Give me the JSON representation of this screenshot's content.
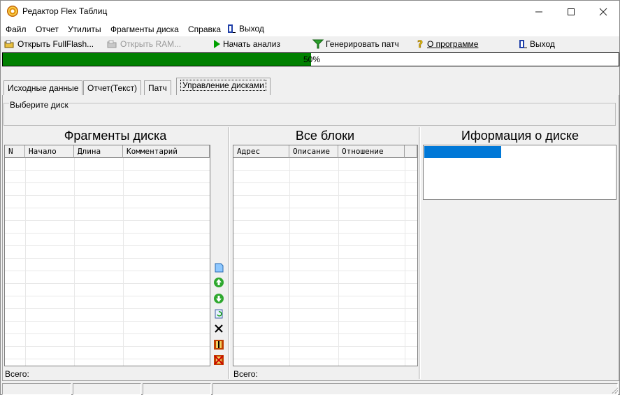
{
  "window": {
    "title": "Редактор Flex Таблиц",
    "controls": {
      "minimize": "—",
      "maximize": "☐",
      "close": "✕"
    }
  },
  "menu": [
    "Файл",
    "Отчет",
    "Утилиты",
    "Фрагменты диска",
    "Справка",
    "Выход"
  ],
  "toolbar": {
    "open_fullflash": "Открыть FullFlash...",
    "open_ram": "Открыть RAM...",
    "start_analysis": "Начать анализ",
    "generate_patch": "Генерировать патч",
    "about": "О программе",
    "exit": "Выход"
  },
  "progress": {
    "value_percent": 50,
    "text": "50%"
  },
  "tabs": [
    "Исходные данные",
    "Отчет(Текст)",
    "Патч",
    "Управление дисками"
  ],
  "active_tab": "Управление дисками",
  "disk_select": {
    "label": "Выберите диск"
  },
  "fragments": {
    "title": "Фрагменты диска",
    "columns": [
      "N",
      "Начало",
      "Длина",
      "Комментарий"
    ],
    "rows": [],
    "total_label": "Всего:"
  },
  "blocks": {
    "title": "Все блоки",
    "columns": [
      "Адрес",
      "Описание",
      "Отношение"
    ],
    "rows": [],
    "total_label": "Всего:"
  },
  "disk_info": {
    "title": "Иформация о диске"
  },
  "side_buttons": [
    "new-fragment",
    "move-up",
    "move-down",
    "refresh",
    "delete",
    "save-table",
    "clear-table"
  ],
  "colors": {
    "progress": "#008000",
    "selection": "#0078d7"
  }
}
